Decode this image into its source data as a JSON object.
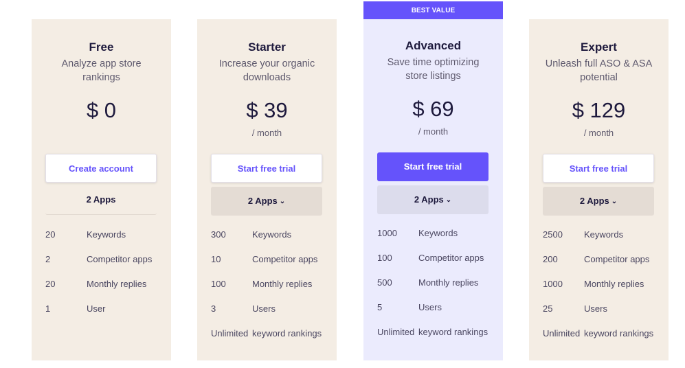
{
  "badge": "BEST VALUE",
  "plans": [
    {
      "name": "Free",
      "subtitle": "Analyze app store rankings",
      "price": "$ 0",
      "period": "",
      "cta": "Create account",
      "apps": "2 Apps",
      "apps_dropdown": false,
      "features": [
        {
          "value": "20",
          "label": "Keywords"
        },
        {
          "value": "2",
          "label": "Competitor apps"
        },
        {
          "value": "20",
          "label": "Monthly replies"
        },
        {
          "value": "1",
          "label": "User"
        }
      ]
    },
    {
      "name": "Starter",
      "subtitle": "Increase your organic downloads",
      "price": "$ 39",
      "period": "/ month",
      "cta": "Start free trial",
      "apps": "2 Apps",
      "apps_dropdown": true,
      "features": [
        {
          "value": "300",
          "label": "Keywords"
        },
        {
          "value": "10",
          "label": "Competitor apps"
        },
        {
          "value": "100",
          "label": "Monthly replies"
        },
        {
          "value": "3",
          "label": "Users"
        },
        {
          "value": "Unlimited",
          "label": "keyword rankings"
        }
      ]
    },
    {
      "name": "Advanced",
      "subtitle": "Save time optimizing store listings",
      "price": "$ 69",
      "period": "/ month",
      "cta": "Start free trial",
      "apps": "2 Apps",
      "apps_dropdown": true,
      "features": [
        {
          "value": "1000",
          "label": "Keywords"
        },
        {
          "value": "100",
          "label": "Competitor apps"
        },
        {
          "value": "500",
          "label": "Monthly replies"
        },
        {
          "value": "5",
          "label": "Users"
        },
        {
          "value": "Unlimited",
          "label": "keyword rankings"
        }
      ]
    },
    {
      "name": "Expert",
      "subtitle": "Unleash full ASO & ASA potential",
      "price": "$ 129",
      "period": "/ month",
      "cta": "Start free trial",
      "apps": "2 Apps",
      "apps_dropdown": true,
      "features": [
        {
          "value": "2500",
          "label": "Keywords"
        },
        {
          "value": "200",
          "label": "Competitor apps"
        },
        {
          "value": "1000",
          "label": "Monthly replies"
        },
        {
          "value": "25",
          "label": "Users"
        },
        {
          "value": "Unlimited",
          "label": "keyword rankings"
        }
      ]
    }
  ],
  "icons": {
    "chevron": "⌄"
  },
  "colors": {
    "accent": "#6553fb",
    "card_bg": "#f4ede4",
    "featured_bg": "#ebebfd",
    "text_dark": "#1e1a3d"
  }
}
